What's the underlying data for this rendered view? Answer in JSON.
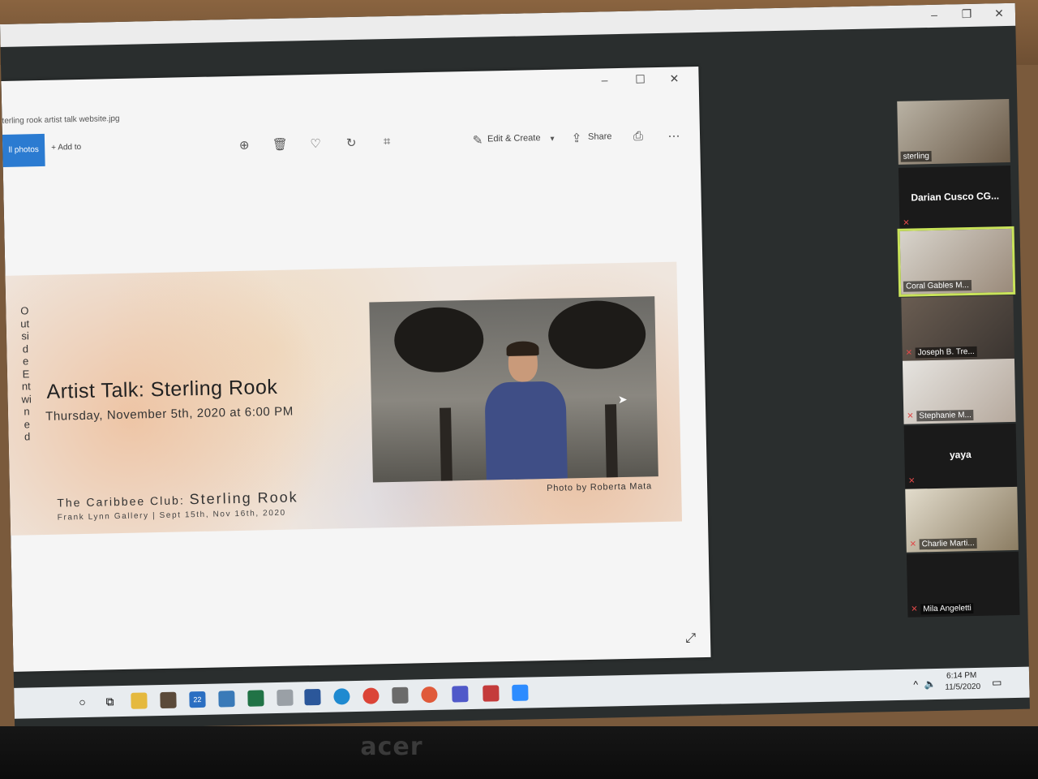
{
  "viewer": {
    "filename": "terling rook artist talk website.jpg",
    "all_photos": "ll photos",
    "add_to": "Add to",
    "edit_create": "Edit & Create",
    "share": "Share"
  },
  "artwork": {
    "vertical_text": "OutsideEntwined",
    "title": "Artist Talk: Sterling Rook",
    "date": "Thursday, November 5th, 2020 at 6:00 PM",
    "exhibit_prefix": "The Caribbee Club:",
    "exhibit_name": "Sterling Rook",
    "gallery": "Frank Lynn Gallery | Sept 15th, Nov 16th, 2020",
    "photo_credit": "Photo by Roberta Mata"
  },
  "participants": [
    {
      "name": "sterling"
    },
    {
      "name": "Darian Cusco CG..."
    },
    {
      "name": "Coral Gables M..."
    },
    {
      "name": "Joseph B. Tre..."
    },
    {
      "name": "Stephanie M..."
    },
    {
      "name": "yaya"
    },
    {
      "name": "Charlie Marti..."
    },
    {
      "name": "Mila Angeletti"
    }
  ],
  "taskbar": {
    "mail_badge": "22",
    "time": "6:14 PM",
    "date": "11/5/2020"
  },
  "monitor": {
    "brand": "acer"
  },
  "colors": {
    "accent": "#2b7bd1",
    "active_speaker": "#c9e35a",
    "muted": "#e04848"
  }
}
